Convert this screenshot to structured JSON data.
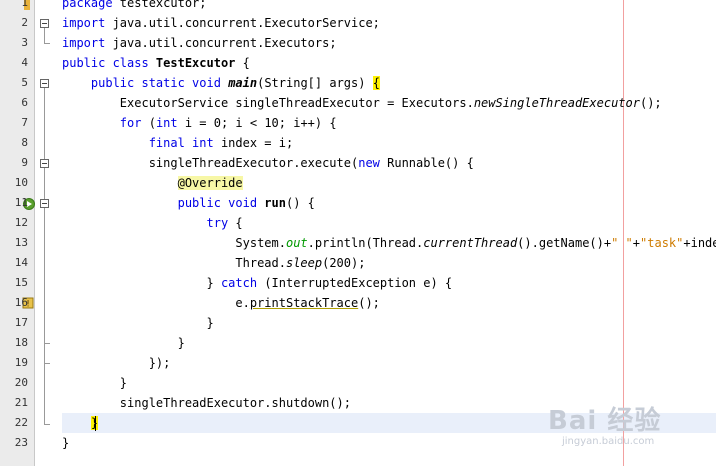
{
  "editor": {
    "line_numbers": [
      "1",
      "2",
      "3",
      "4",
      "5",
      "6",
      "7",
      "8",
      "9",
      "10",
      "11",
      "12",
      "13",
      "14",
      "15",
      "16",
      "17",
      "18",
      "19",
      "20",
      "21",
      "22",
      "23"
    ],
    "lines": [
      [
        {
          "t": "package ",
          "c": "kw"
        },
        {
          "t": "testexcutor;"
        }
      ],
      [
        {
          "t": "import ",
          "c": "kw"
        },
        {
          "t": "java.util.concurrent.ExecutorService;"
        }
      ],
      [
        {
          "t": "import ",
          "c": "kw"
        },
        {
          "t": "java.util.concurrent.Executors;"
        }
      ],
      [
        {
          "t": "public class ",
          "c": "kw"
        },
        {
          "t": "TestExcutor",
          "c": "bold"
        },
        {
          "t": " {"
        }
      ],
      [
        {
          "t": "    "
        },
        {
          "t": "public static void ",
          "c": "kw"
        },
        {
          "t": "main",
          "c": "bold it"
        },
        {
          "t": "(String[] args) "
        },
        {
          "t": "{",
          "c": "yel"
        }
      ],
      [
        {
          "t": "        ExecutorService singleThreadExecutor = Executors."
        },
        {
          "t": "newSingleThreadExecutor",
          "c": "it"
        },
        {
          "t": "();"
        }
      ],
      [
        {
          "t": "        "
        },
        {
          "t": "for ",
          "c": "kw"
        },
        {
          "t": "("
        },
        {
          "t": "int",
          "c": "kw"
        },
        {
          "t": " i = 0; i < 10; i++) {"
        }
      ],
      [
        {
          "t": "            "
        },
        {
          "t": "final int ",
          "c": "kw"
        },
        {
          "t": "index = i;"
        }
      ],
      [
        {
          "t": "            singleThreadExecutor.execute("
        },
        {
          "t": "new ",
          "c": "kw"
        },
        {
          "t": "Runnable() {"
        }
      ],
      [
        {
          "t": "                "
        },
        {
          "t": "@Override",
          "c": "ann"
        }
      ],
      [
        {
          "t": "                "
        },
        {
          "t": "public void ",
          "c": "kw"
        },
        {
          "t": "run",
          "c": "bold"
        },
        {
          "t": "() {"
        }
      ],
      [
        {
          "t": "                    "
        },
        {
          "t": "try ",
          "c": "kw"
        },
        {
          "t": "{"
        }
      ],
      [
        {
          "t": "                        System."
        },
        {
          "t": "out",
          "c": "fld"
        },
        {
          "t": ".println(Thread."
        },
        {
          "t": "currentThread",
          "c": "it"
        },
        {
          "t": "().getName()+"
        },
        {
          "t": "\" \"",
          "c": "str"
        },
        {
          "t": "+"
        },
        {
          "t": "\"task\"",
          "c": "str"
        },
        {
          "t": "+index);"
        }
      ],
      [
        {
          "t": "                        Thread."
        },
        {
          "t": "sleep",
          "c": "it"
        },
        {
          "t": "(200);"
        }
      ],
      [
        {
          "t": "                    } "
        },
        {
          "t": "catch ",
          "c": "kw"
        },
        {
          "t": "(InterruptedException e) {"
        }
      ],
      [
        {
          "t": "                        e."
        },
        {
          "t": "printStackTrace",
          "c": "uline"
        },
        {
          "t": "();"
        }
      ],
      [
        {
          "t": "                    }"
        }
      ],
      [
        {
          "t": "                }"
        }
      ],
      [
        {
          "t": "            });"
        }
      ],
      [
        {
          "t": "        }"
        }
      ],
      [
        {
          "t": "        singleThreadExecutor.shutdown();"
        }
      ],
      [
        {
          "t": "    "
        },
        {
          "t": "}",
          "c": "yel"
        }
      ],
      [
        {
          "t": "}"
        }
      ]
    ]
  },
  "watermark": {
    "brand": "Bai 经验",
    "url": "jingyan.baidu.com"
  },
  "colors": {
    "keyword": "#0000e6",
    "string": "#ce7b00",
    "field": "#009900",
    "current_line": "#e9effa",
    "margin_line": "#f2a0a0"
  }
}
